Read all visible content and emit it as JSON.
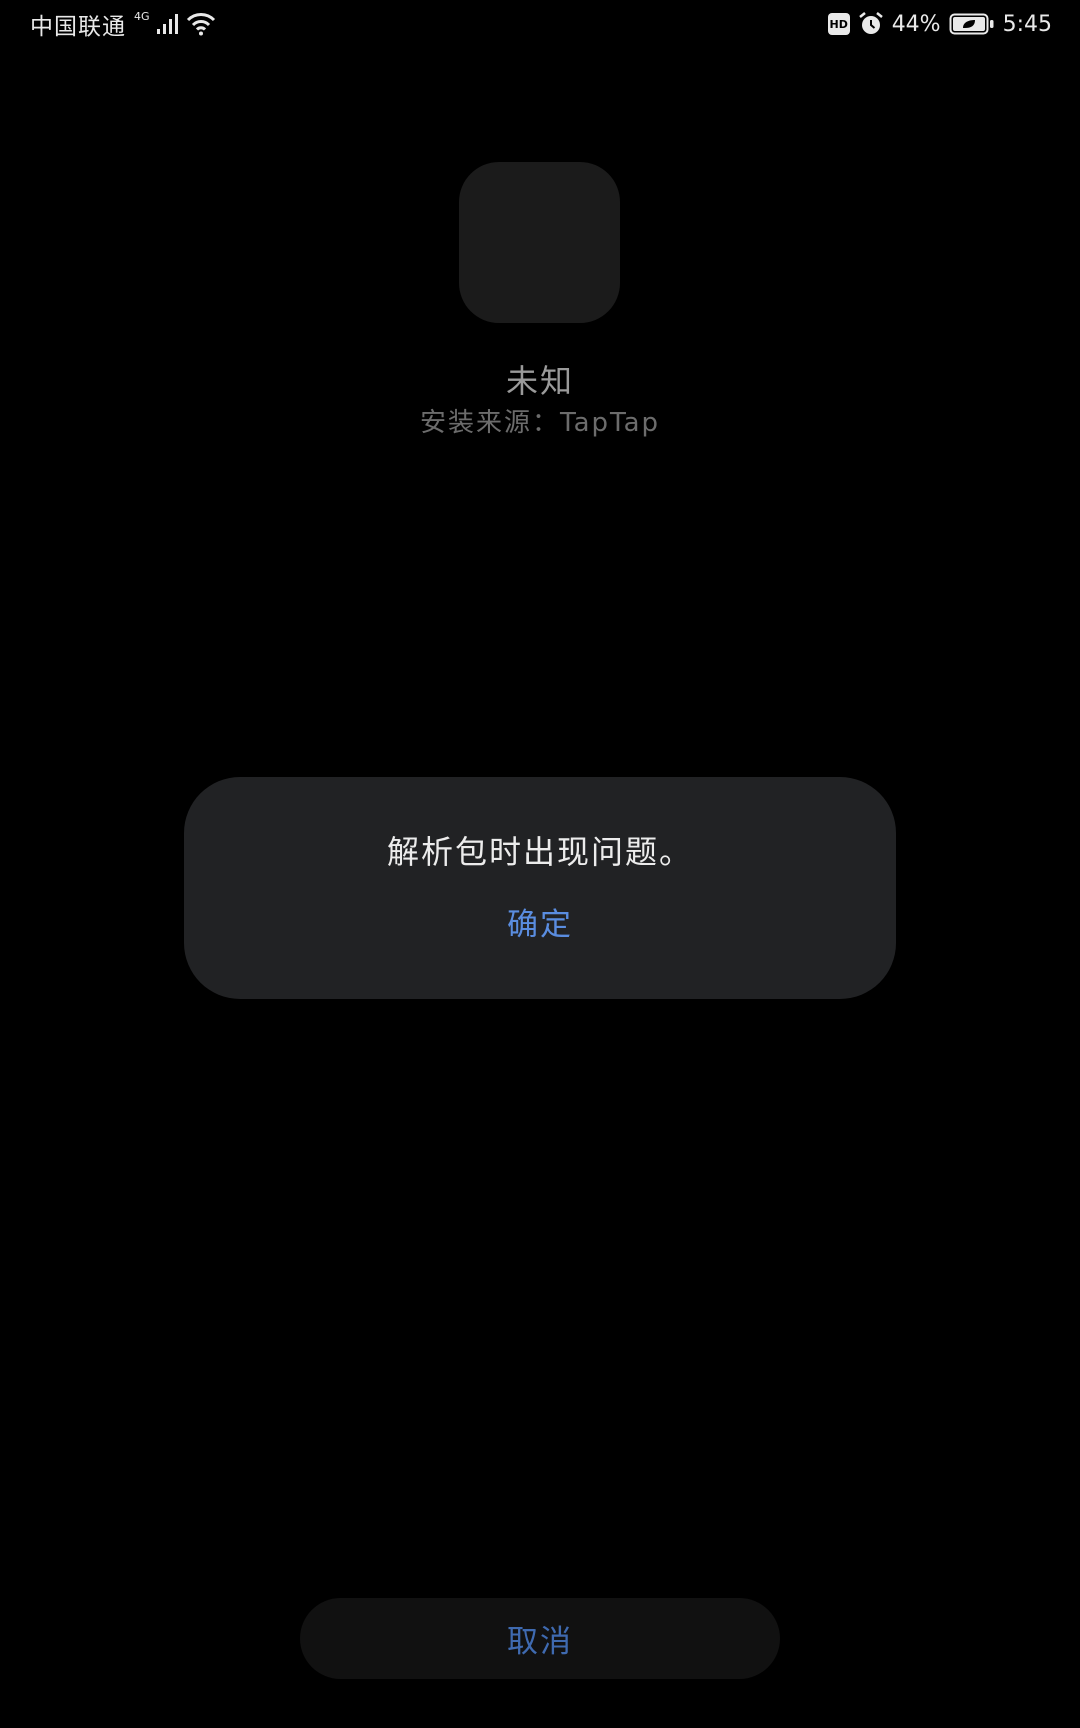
{
  "status_bar": {
    "carrier": "中国联通",
    "network_type": "4G",
    "hd_badge": "HD",
    "battery_percent": "44%",
    "time": "5:45",
    "icons": [
      "signal-icon",
      "wifi-icon",
      "hd-icon",
      "alarm-icon",
      "battery-icon"
    ]
  },
  "app": {
    "icon": "app-placeholder-icon",
    "name": "未知",
    "install_source": "安装来源：TapTap"
  },
  "dialog": {
    "message": "解析包时出现问题。",
    "confirm_label": "确定"
  },
  "footer": {
    "cancel_label": "取消"
  },
  "colors": {
    "background": "#000000",
    "dialog_background": "#212224",
    "accent": "#5a8de0",
    "cancel_text": "#3f6ab0"
  }
}
